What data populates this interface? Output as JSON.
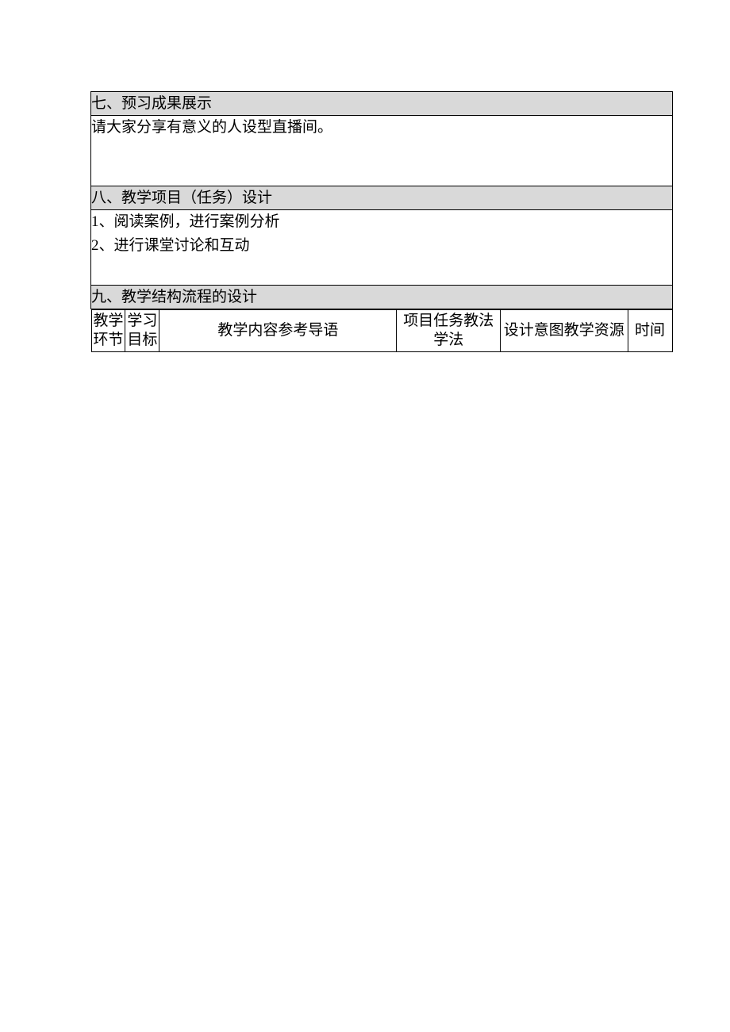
{
  "sections": {
    "s7": {
      "header": "七、预习成果展示",
      "body": "请大家分享有意义的人设型直播间。"
    },
    "s8": {
      "header": "八、教学项目（任务）设计",
      "body_line1": "1、阅读案例，进行案例分析",
      "body_line2": "2、进行课堂讨论和互动"
    },
    "s9": {
      "header": "九、教学结构流程的设计",
      "cols": {
        "c1": "教学环节",
        "c2": "学习目标",
        "c3": "教学内容参考导语",
        "c4": "项目任务教法学法",
        "c5": "设计意图教学资源",
        "c6": "时间"
      }
    }
  }
}
